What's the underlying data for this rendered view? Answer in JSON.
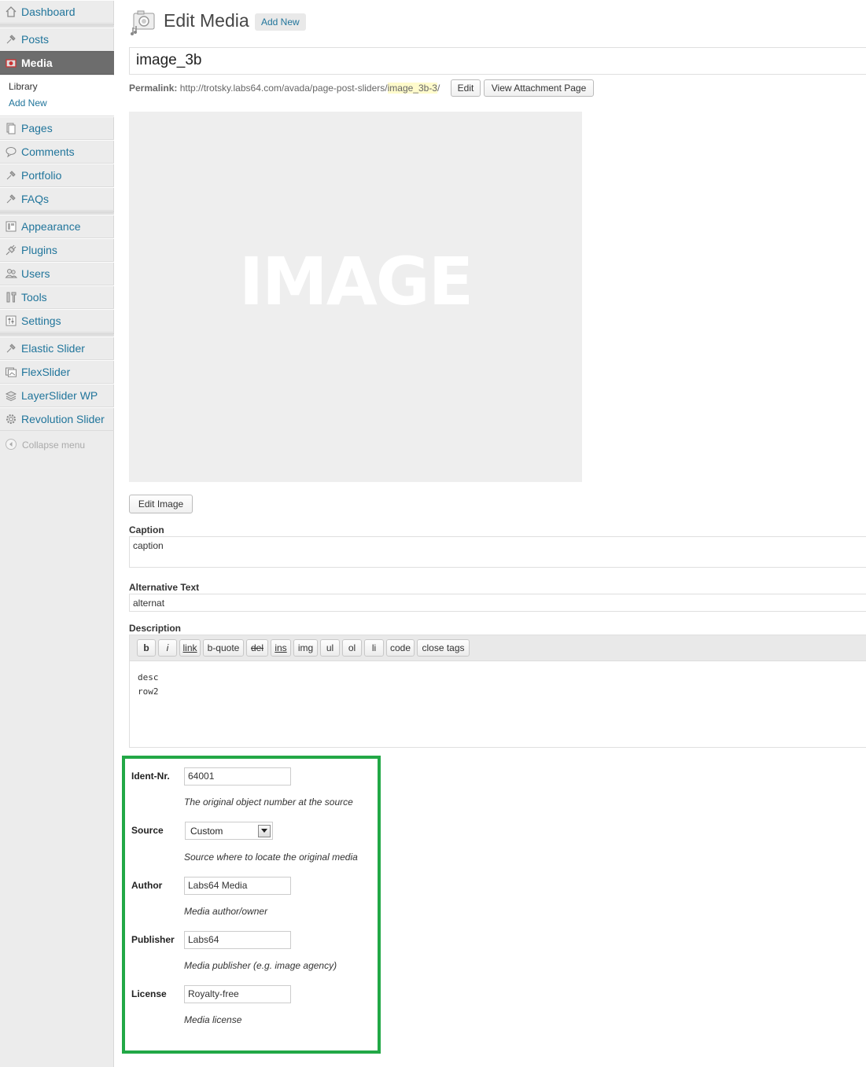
{
  "sidebar": {
    "items": [
      {
        "label": "Dashboard",
        "icon": "home-icon"
      },
      {
        "label": "Posts",
        "icon": "pin-icon"
      },
      {
        "label": "Media",
        "icon": "media-icon"
      },
      {
        "label": "Pages",
        "icon": "pages-icon"
      },
      {
        "label": "Comments",
        "icon": "comments-icon"
      },
      {
        "label": "Portfolio",
        "icon": "pin-icon"
      },
      {
        "label": "FAQs",
        "icon": "pin-icon"
      },
      {
        "label": "Appearance",
        "icon": "appearance-icon"
      },
      {
        "label": "Plugins",
        "icon": "plugins-icon"
      },
      {
        "label": "Users",
        "icon": "users-icon"
      },
      {
        "label": "Tools",
        "icon": "tools-icon"
      },
      {
        "label": "Settings",
        "icon": "settings-icon"
      },
      {
        "label": "Elastic Slider",
        "icon": "pin-icon"
      },
      {
        "label": "FlexSlider",
        "icon": "gallery-icon"
      },
      {
        "label": "LayerSlider WP",
        "icon": "layers-icon"
      },
      {
        "label": "Revolution Slider",
        "icon": "gear-icon"
      }
    ],
    "submenu": {
      "library": "Library",
      "add_new": "Add New"
    },
    "collapse": "Collapse menu"
  },
  "header": {
    "title": "Edit Media",
    "add_new": "Add New"
  },
  "post_title": "image_3b",
  "permalink": {
    "label": "Permalink:",
    "base": "http://trotsky.labs64.com/avada/page-post-sliders/",
    "slug": "image_3b-3",
    "trail": "/",
    "edit_button": "Edit",
    "view_button": "View Attachment Page"
  },
  "image_placeholder": "IMAGE",
  "edit_image_button": "Edit Image",
  "caption": {
    "label": "Caption",
    "value": "caption"
  },
  "alt_text": {
    "label": "Alternative Text",
    "value": "alternat"
  },
  "description": {
    "label": "Description",
    "toolbar": [
      "b",
      "i",
      "link",
      "b-quote",
      "del",
      "ins",
      "img",
      "ul",
      "ol",
      "li",
      "code",
      "close tags"
    ],
    "lines": [
      "desc",
      "row2"
    ]
  },
  "meta_fields": {
    "ident": {
      "label": "Ident-Nr.",
      "value": "64001",
      "help": "The original object number at the source"
    },
    "source": {
      "label": "Source",
      "value": "Custom",
      "help": "Source where to locate the original media"
    },
    "author": {
      "label": "Author",
      "value": "Labs64 Media",
      "help": "Media author/owner"
    },
    "publisher": {
      "label": "Publisher",
      "value": "Labs64",
      "help": "Media publisher (e.g. image agency)"
    },
    "license": {
      "label": "License",
      "value": "Royalty-free",
      "help": "Media license"
    }
  },
  "colors": {
    "link": "#21759b",
    "highlight_box": "#22a846",
    "current_menu": "#6d6d6d"
  }
}
